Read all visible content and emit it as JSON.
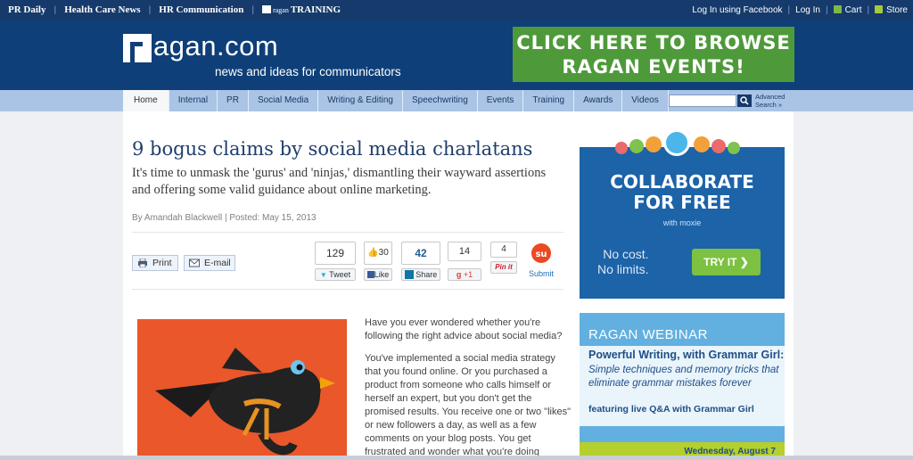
{
  "topbar": {
    "links": [
      "PR Daily",
      "Health Care News",
      "HR Communication",
      "TRAINING"
    ],
    "training_brand": "ragan",
    "right_links": [
      "Log In using Facebook",
      "Log In",
      "Cart",
      "Store"
    ]
  },
  "header": {
    "logo_text": "agan.com",
    "tagline": "news and ideas for communicators",
    "events_banner_line1": "CLICK HERE TO BROWSE",
    "events_banner_line2": "RAGAN EVENTS!"
  },
  "nav": {
    "tabs": [
      "Home",
      "Internal",
      "PR",
      "Social Media",
      "Writing & Editing",
      "Speechwriting",
      "Events",
      "Training",
      "Awards",
      "Videos"
    ],
    "search_placeholder": "",
    "advanced_search_line1": "Advanced",
    "advanced_search_line2": "Search »"
  },
  "article": {
    "title": "9 bogus claims by social media charlatans",
    "subtitle": "It's time to unmask the 'gurus' and 'ninjas,' dismantling their wayward assertions and offering some valid guidance about online marketing.",
    "byline": "By Amandah Blackwell | Posted: May 15, 2013",
    "print_label": "Print",
    "email_label": "E-mail",
    "share": {
      "tweet_count": "129",
      "tweet_label": "Tweet",
      "like_count": "30",
      "like_label": "Like",
      "linkedin_count": "42",
      "linkedin_label": "Share",
      "gplus_count": "14",
      "gplus_label": "+1",
      "pinit_count": "4",
      "pinit_label": "Pin it",
      "stumble_label": "Submit"
    },
    "paragraphs": [
      "Have you ever wondered whether you're following the right advice about social media?",
      "You've implemented a social media strategy that you found online. Or you purchased a product from someone who calls himself or herself an expert, but you don't get the promised results. You receive one or two \"likes\" or new followers a day, as well as a few comments on your blog posts. You get frustrated and wonder what you're doing"
    ]
  },
  "sidebar": {
    "collab": {
      "headline_line1": "COLLABORATE",
      "headline_line2": "FOR FREE",
      "with_text": "with moxie",
      "nocost_line1": "No cost.",
      "nocost_line2": "No limits.",
      "button_label": "TRY IT ❯"
    },
    "webinar": {
      "kicker": "RAGAN WEBINAR",
      "title": "Powerful Writing, with Grammar Girl:",
      "description": "Simple techniques and memory tricks that eliminate grammar mistakes forever",
      "featuring": "featuring live Q&A with Grammar Girl",
      "date_teaser": "Wednesday, August 7"
    }
  },
  "colors": {
    "header_blue": "#0f3f78",
    "nav_blue": "#a9c4e5",
    "banner_green": "#4e9a3a",
    "title_blue": "#1f3e6c"
  }
}
